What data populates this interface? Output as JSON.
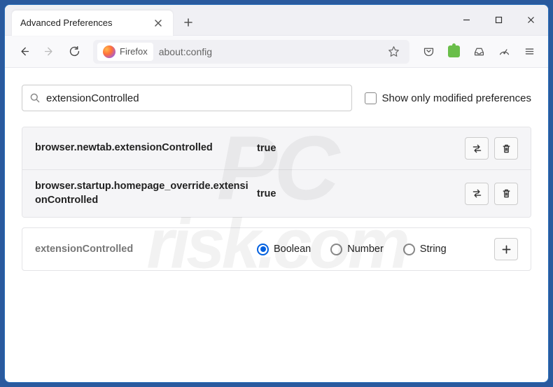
{
  "window": {
    "tab_title": "Advanced Preferences"
  },
  "toolbar": {
    "identity_label": "Firefox",
    "url": "about:config"
  },
  "search": {
    "value": "extensionControlled",
    "checkbox_label": "Show only modified preferences"
  },
  "prefs": [
    {
      "name": "browser.newtab.extensionControlled",
      "value": "true"
    },
    {
      "name": "browser.startup.homepage_override.extensionControlled",
      "value": "true"
    }
  ],
  "add": {
    "name": "extensionControlled",
    "types": [
      "Boolean",
      "Number",
      "String"
    ],
    "selected": "Boolean"
  }
}
